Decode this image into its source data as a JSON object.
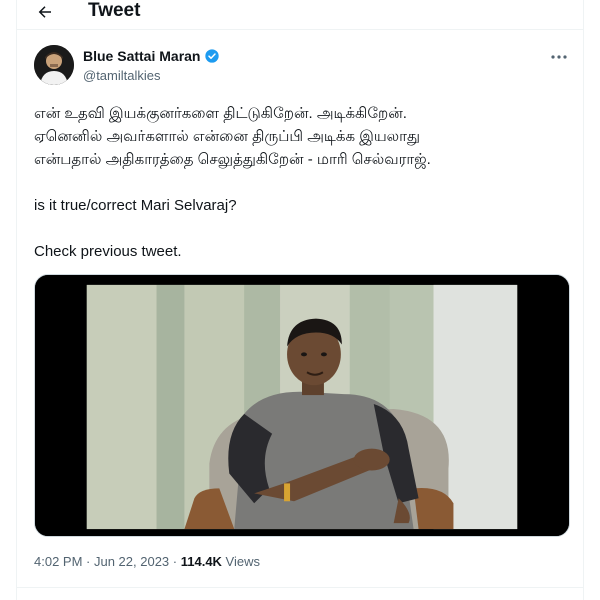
{
  "header": {
    "title": "Tweet",
    "back_icon": "arrow-left-icon"
  },
  "author": {
    "display_name": "Blue Sattai Maran",
    "handle": "@tamiltalkies",
    "verified": true,
    "verified_color": "#1d9bf0"
  },
  "tweet": {
    "lines": [
      "என் உதவி இயக்குனர்களை திட்டுகிறேன். அடிக்கிறேன்.",
      "ஏனெனில் அவர்களால் என்னை திருப்பி அடிக்க இயலாது",
      "என்பதால் அதிகாரத்தை செலுத்துகிறேன் - மாரி  செல்வராஜ்.",
      "is it true/correct Mari Selvaraj?",
      "Check previous tweet."
    ]
  },
  "meta": {
    "time": "4:02 PM",
    "separator": " · ",
    "date": "Jun 22, 2023",
    "views_count": "114.4K",
    "views_label": " Views"
  },
  "colors": {
    "text": "#0f1419",
    "secondary": "#536471",
    "accent": "#1d9bf0",
    "divider": "#eff3f4"
  }
}
